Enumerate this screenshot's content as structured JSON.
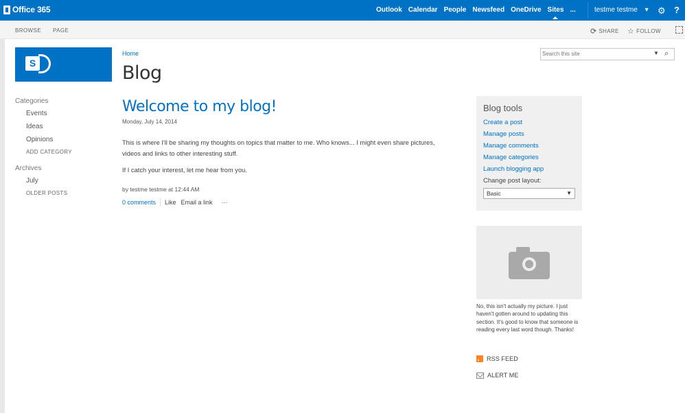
{
  "suite": {
    "brand": "Office 365",
    "nav": [
      "Outlook",
      "Calendar",
      "People",
      "Newsfeed",
      "OneDrive",
      "Sites",
      "..."
    ],
    "active_nav": "Sites",
    "user": "testme testme",
    "user_chevron": "▾",
    "settings_icon": "gear-icon",
    "help_glyph": "?"
  },
  "ribbon": {
    "tabs": [
      "BROWSE",
      "PAGE"
    ],
    "share": "SHARE",
    "follow": "FOLLOW"
  },
  "header": {
    "breadcrumb": "Home",
    "title": "Blog",
    "logo_letter": "S"
  },
  "search": {
    "placeholder": "Search this site"
  },
  "left_nav": {
    "categories_heading": "Categories",
    "categories": [
      "Events",
      "Ideas",
      "Opinions"
    ],
    "add_category": "ADD CATEGORY",
    "archives_heading": "Archives",
    "archives": [
      "July"
    ],
    "older_posts": "OLDER POSTS"
  },
  "post": {
    "title": "Welcome to my blog!",
    "date": "Monday, July 14, 2014",
    "paragraphs": [
      "This is where I'll be sharing my thoughts on topics that matter to me. Who knows... I might even share pictures, videos and links to other interesting stuff.",
      "If I catch your interest, let me hear from you."
    ],
    "byline": "by testme testme at 12:44 AM",
    "comments": "0 comments",
    "like": "Like",
    "email": "Email a link",
    "more": "···"
  },
  "blog_tools": {
    "title": "Blog tools",
    "links": [
      "Create a post",
      "Manage posts",
      "Manage comments",
      "Manage categories",
      "Launch blogging app"
    ],
    "layout_label": "Change post layout:",
    "layout_value": "Basic"
  },
  "about": {
    "caption": "No, this isn't actually my picture. I just haven't gotten around to updating this section. It's good to know that someone is reading every last word though. Thanks!"
  },
  "feeds": {
    "rss": "RSS FEED",
    "alert": "ALERT ME"
  },
  "colors": {
    "brand_blue": "#0072c6",
    "rss_orange": "#f78422"
  }
}
